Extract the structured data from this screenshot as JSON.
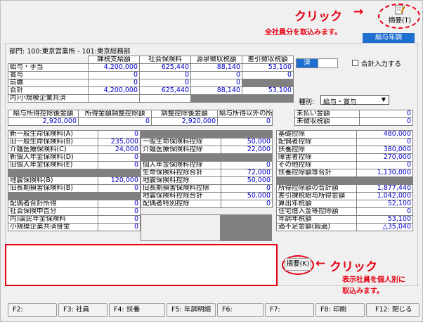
{
  "annotations": {
    "click_top": "クリック",
    "arrow_top": "→",
    "note_top": "全社員分を取込みます。",
    "click_bottom": "クリック",
    "arrow_bottom": "←",
    "note_bottom_1": "表示社員を個人別に",
    "note_bottom_2": "取込みます。"
  },
  "toolbar": {
    "summary_t": "摘要(T)",
    "kyuyo_nencho": "給与年調"
  },
  "department": "部門: 100:東京営業所 - 101:東京総務部",
  "top_table": {
    "headers": [
      "課税支給額",
      "社会保険料",
      "源泉徴収税額",
      "差引徴収税額"
    ],
    "rows": [
      {
        "label": "給与・手当",
        "values": [
          "4,200,000",
          "625,440",
          "88,140",
          "53,100"
        ]
      },
      {
        "label": "賞与",
        "values": [
          "0",
          "0",
          "0",
          "0"
        ]
      },
      {
        "label": "前職",
        "values": [
          "0",
          "0",
          "0",
          ""
        ]
      },
      {
        "label": "合計",
        "values": [
          "4,200,000",
          "625,440",
          "88,140",
          "53,100"
        ]
      },
      {
        "label": "内)小規模企業共済",
        "values": [
          "",
          "",
          "",
          ""
        ]
      }
    ]
  },
  "toggle": {
    "on": "済",
    "off": ""
  },
  "total_input_label": "合計入力する",
  "kind": {
    "label": "種別:",
    "value": "給与・賞与"
  },
  "deduction_table": {
    "headers": [
      "給与所得控除後金額",
      "所得金額調整控除額",
      "調整控除後金額",
      "給与所得以外の所得"
    ],
    "values": [
      "2,920,000",
      "0",
      "2,920,000",
      "0"
    ]
  },
  "unpaid": [
    {
      "label": "未払い金額",
      "value": "0"
    },
    {
      "label": "未徴収税額",
      "value": "0"
    }
  ],
  "left_col": [
    {
      "label": "新一般生命保険料(A)",
      "value": "0"
    },
    {
      "label": "旧一般生命保険料(B)",
      "value": "235,000"
    },
    {
      "label": "介護医療保険料(C)",
      "value": "24,000"
    },
    {
      "label": "新個人年金保険料(D)",
      "value": "0"
    },
    {
      "label": "旧個人年金保険料(E)",
      "value": "0"
    },
    {
      "label": "",
      "value": ""
    },
    {
      "label": "地震保険料(B)",
      "value": "120,000"
    },
    {
      "label": "旧長期損害保険料(B)",
      "value": "0"
    },
    {
      "label": "",
      "value": ""
    },
    {
      "label": "配偶者合計所得",
      "value": "0"
    },
    {
      "label": "社会保険申告分",
      "value": "0"
    },
    {
      "label": "内)国民年金保険料",
      "value": "0"
    },
    {
      "label": "小規模企業共済掛金",
      "value": "0"
    }
  ],
  "mid_col": [
    {
      "label": "",
      "value": ""
    },
    {
      "label": "一般生命保険料控除",
      "value": "50,000"
    },
    {
      "label": "介護医療保険料控除",
      "value": "22,000"
    },
    {
      "label": "",
      "value": ""
    },
    {
      "label": "個人年金保険料控除",
      "value": "0"
    },
    {
      "label": "生命保険料控除合計",
      "value": "72,000"
    },
    {
      "label": "地震保険料控除",
      "value": "50,000"
    },
    {
      "label": "旧長期損害保険料控除",
      "value": "0"
    },
    {
      "label": "地震保険料控除合計",
      "value": "50,000"
    },
    {
      "label": "配偶者特別控除",
      "value": "0"
    }
  ],
  "right_col": [
    {
      "label": "基礎控除",
      "value": "480,000"
    },
    {
      "label": "配偶者控除",
      "value": "0"
    },
    {
      "label": "扶養控除",
      "value": "380,000"
    },
    {
      "label": "障害者控除",
      "value": "270,000"
    },
    {
      "label": "その他控除",
      "value": "0"
    },
    {
      "label": "扶養控除額等合計",
      "value": "1,130,000"
    },
    {
      "label": "",
      "value": ""
    },
    {
      "label": "所得控除額の合計額",
      "value": "1,877,440"
    },
    {
      "label": "差引課税給与所得金額",
      "value": "1,042,000"
    },
    {
      "label": "算出年税額",
      "value": "52,100"
    },
    {
      "label": "住宅借入金等控除額",
      "value": "0"
    },
    {
      "label": "年調年税額",
      "value": "53,100"
    },
    {
      "label": "過不足金額(超過)",
      "value": "△35,040"
    }
  ],
  "summary_k": "摘要(K)",
  "fkeys": [
    {
      "key": "F2:",
      "label": ""
    },
    {
      "key": "F3:",
      "label": "社員"
    },
    {
      "key": "F4:",
      "label": "扶養"
    },
    {
      "key": "F5:",
      "label": "年調明細"
    },
    {
      "key": "F6:",
      "label": ""
    },
    {
      "key": "F7:",
      "label": ""
    },
    {
      "key": "F8:",
      "label": "印刷"
    },
    {
      "key": "F12:",
      "label": "閉じる"
    }
  ]
}
